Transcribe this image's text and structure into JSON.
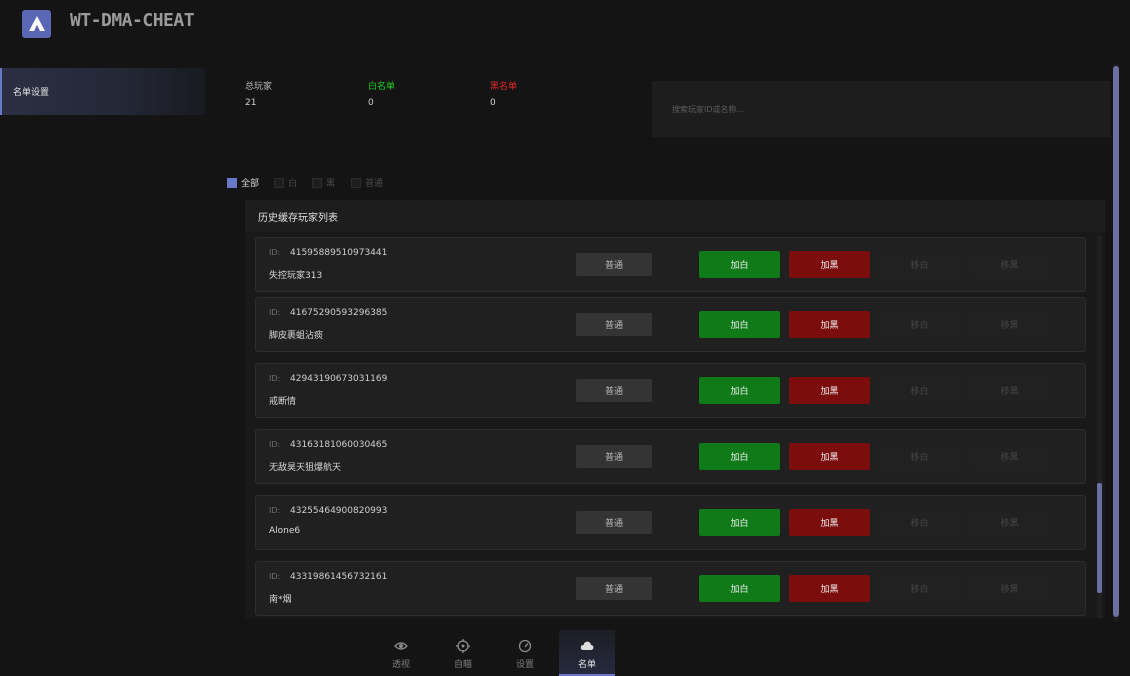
{
  "app": {
    "title": "WT-DMA-CHEAT",
    "accent": "#6b77c9"
  },
  "sidebar": {
    "items": [
      {
        "label": "名单设置"
      }
    ]
  },
  "stats": {
    "total": {
      "label": "总玩家",
      "value": "21",
      "color": "#d0d0d0"
    },
    "white": {
      "label": "白名单",
      "value": "0",
      "color": "#19d11f"
    },
    "black": {
      "label": "黑名单",
      "value": "0",
      "color": "#e12828"
    }
  },
  "search": {
    "placeholder": "搜索玩家ID或名称...",
    "value": ""
  },
  "filters": [
    {
      "label": "全部",
      "checked": true
    },
    {
      "label": "白",
      "checked": false
    },
    {
      "label": "黑",
      "checked": false
    },
    {
      "label": "普通",
      "checked": false
    }
  ],
  "list": {
    "title": "历史缓存玩家列表",
    "id_label": "ID:",
    "buttons": {
      "normal": "普通",
      "add_white": "加白",
      "add_black": "加黑",
      "remove_white": "移白",
      "remove_black": "移黑"
    },
    "players": [
      {
        "id": "41595889510973441",
        "name": "失控玩家313"
      },
      {
        "id": "41675290593296385",
        "name": "脚皮裹蛆沾痰"
      },
      {
        "id": "42943190673031169",
        "name": "戒断情"
      },
      {
        "id": "43163181060030465",
        "name": "无敌昊天狙爆航天"
      },
      {
        "id": "43255464900820993",
        "name": "Alone6"
      },
      {
        "id": "43319861456732161",
        "name": "南*烟"
      }
    ]
  },
  "bottom_nav": [
    {
      "label": "透视",
      "icon": "eye-icon",
      "active": false
    },
    {
      "label": "自瞄",
      "icon": "crosshair-icon",
      "active": false
    },
    {
      "label": "设置",
      "icon": "gauge-icon",
      "active": false
    },
    {
      "label": "名单",
      "icon": "cloud-icon",
      "active": true
    }
  ]
}
